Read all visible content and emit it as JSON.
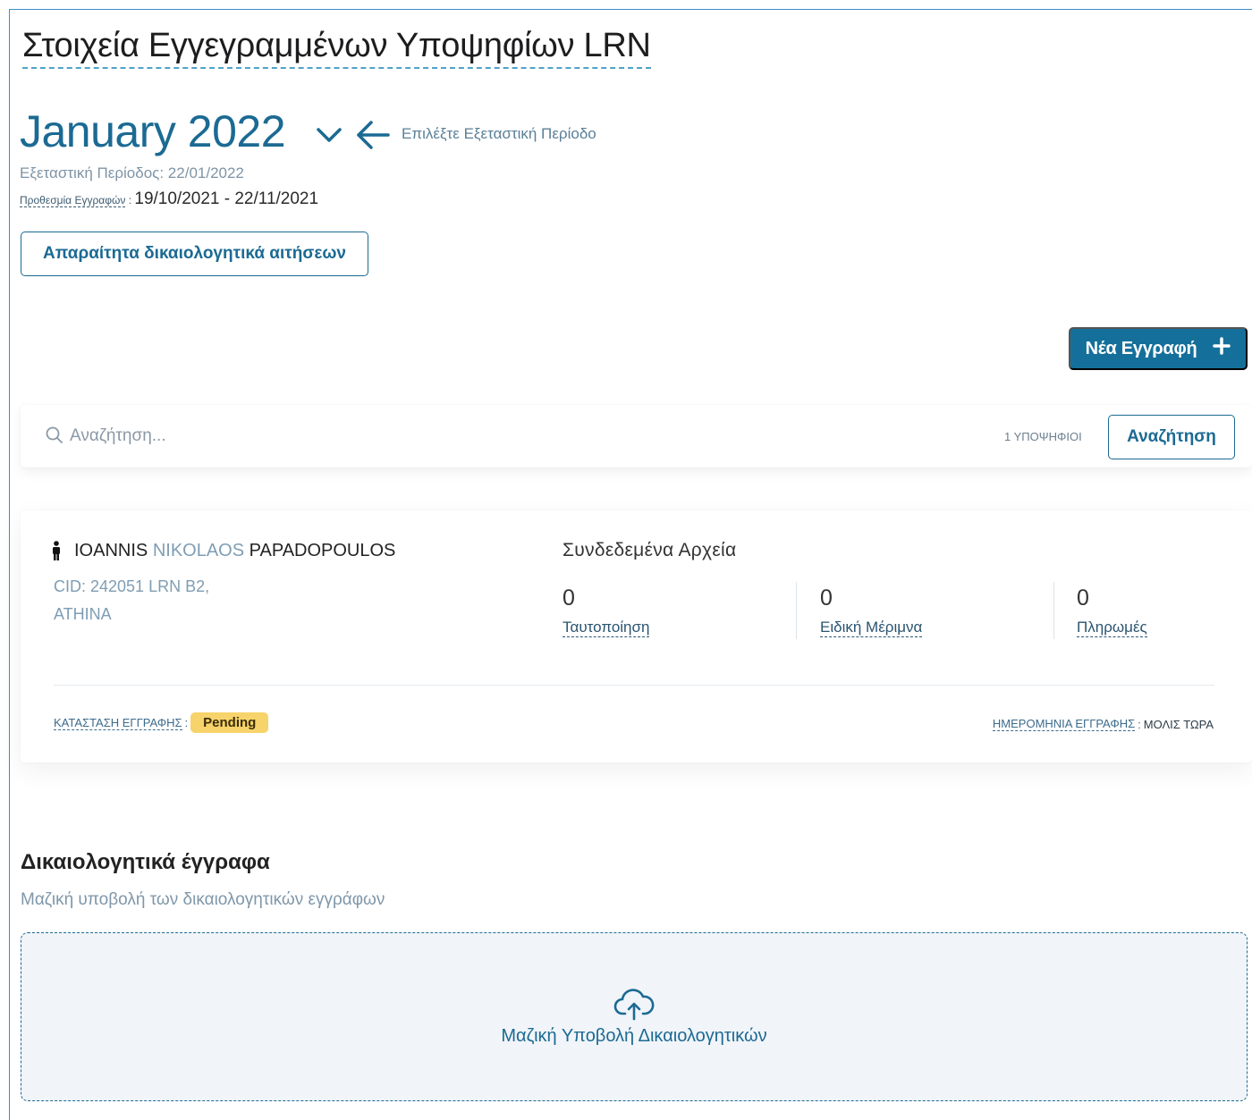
{
  "page": {
    "title": "Στοιχεία Εγγεγραμμένων Υποψηφίων LRN"
  },
  "period": {
    "title": "January 2022",
    "select_hint": "Επιλέξτε Εξεταστική Περίοδο",
    "exam_period_label": "Εξεταστική Περίοδος: 22/01/2022",
    "deadline_label": "Προθεσμία Εγγραφών",
    "deadline_value": "19/10/2021 - 22/11/2021",
    "icons": {
      "dropdown": "chevron-down-icon",
      "back": "arrow-left-icon"
    }
  },
  "buttons": {
    "required_docs": "Απαραίτητα δικαιολογητικά αιτήσεων",
    "new_registration": "Νέα Εγγραφή",
    "new_registration_icon": "plus-icon",
    "search": "Αναζήτηση"
  },
  "search": {
    "placeholder": "Αναζήτηση...",
    "value": "",
    "count_label": "1 ΥΠΟΨΗΦΙΟΙ"
  },
  "candidate": {
    "first_name": "IOANNIS",
    "middle_name": "NIKOLAOS",
    "last_name": "PAPADOPOULOS",
    "cid_line": "CID: 242051 LRN B2,",
    "city": "ATHINA",
    "files_title": "Συνδεδεμένα Αρχεία",
    "files": [
      {
        "count": "0",
        "label": "Ταυτοποίηση"
      },
      {
        "count": "0",
        "label": "Ειδική Μέριμνα"
      },
      {
        "count": "0",
        "label": "Πληρωμές"
      }
    ],
    "status_label": "ΚΑΤΑΣΤΑΣΗ ΕΓΓΡΑΦΗΣ",
    "status_value": "Pending",
    "date_label": "ΗΜΕΡΟΜΗΝΙΑ ΕΓΓΡΑΦΗΣ",
    "date_value": "ΜΟΛΙΣ ΤΩΡΑ"
  },
  "documents": {
    "title": "Δικαιολογητικά έγγραφα",
    "subtitle": "Μαζική υποβολή των δικαιολογητικών εγγράφων",
    "upload_label": "Μαζική Υποβολή Δικαιολογητικών",
    "upload_icon": "cloud-upload-icon"
  },
  "colors": {
    "primary": "#1b6a93",
    "primary_button": "#14709a",
    "pending_badge": "#f7d36b",
    "muted_text": "#7f9db4"
  }
}
